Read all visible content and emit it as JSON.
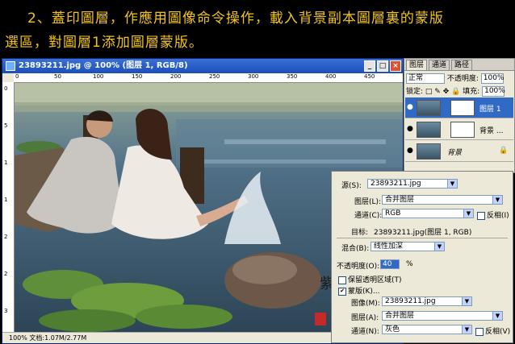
{
  "banner": {
    "line1": "2、蓋印圖層，作應用圖像命令操作，載入背景副本圖層裏的蒙版",
    "line2": "選區，對圖層1添加圖層蒙版。"
  },
  "document": {
    "title": "23893211.jpg @ 100% (图层 1, RGB/8)",
    "min_label": "_",
    "max_label": "□",
    "close_label": "×",
    "status": "100%     文档:1.07M/2.77M"
  },
  "ruler": {
    "h_ticks": [
      "0",
      "50",
      "100",
      "150",
      "200",
      "250",
      "300",
      "350",
      "400",
      "450"
    ],
    "v_ticks": [
      "0",
      "5",
      "1",
      "1",
      "2",
      "2",
      "3"
    ]
  },
  "layers_panel": {
    "tabs": [
      "图层",
      "通道",
      "路径"
    ],
    "blend_mode": "正常",
    "opacity_label": "不透明度:",
    "opacity_value": "100%",
    "lock_label": "锁定:",
    "fill_label": "填充:",
    "fill_value": "100%",
    "items": [
      {
        "name": "图层 1",
        "selected": true,
        "has_mask": true
      },
      {
        "name": "背景 ...",
        "selected": false,
        "has_mask": true
      },
      {
        "name": "背景",
        "selected": false,
        "has_mask": false
      }
    ]
  },
  "apply_image": {
    "source_label": "源(S):",
    "source_value": "23893211.jpg",
    "layer_label": "图层(L):",
    "layer_value": "合并图层",
    "channel_label": "通道(C):",
    "channel_value": "RGB",
    "invert_label": "反相(I)",
    "target_label": "目标:",
    "target_value": "23893211.jpg(图层 1, RGB)",
    "blending_label": "混合(B):",
    "blending_value": "线性加深",
    "opacity_label": "不透明度(O):",
    "opacity_value": "40",
    "opacity_unit": "%",
    "preserve_label": "保留透明区域(T)",
    "mask_label": "蒙版(K)...",
    "mask_checked": true,
    "mask_image_label": "图像(M):",
    "mask_image_value": "23893211.jpg",
    "mask_layer_label": "图层(A):",
    "mask_layer_value": "合并图层",
    "mask_channel_label": "通道(N):",
    "mask_channel_value": "灰色",
    "mask_invert_label": "反相(V)"
  },
  "colors": {
    "banner_text": "#f2c418",
    "titlebar": "#2a5fc8",
    "panel_bg": "#ece9d8",
    "selection": "#316ac5"
  }
}
